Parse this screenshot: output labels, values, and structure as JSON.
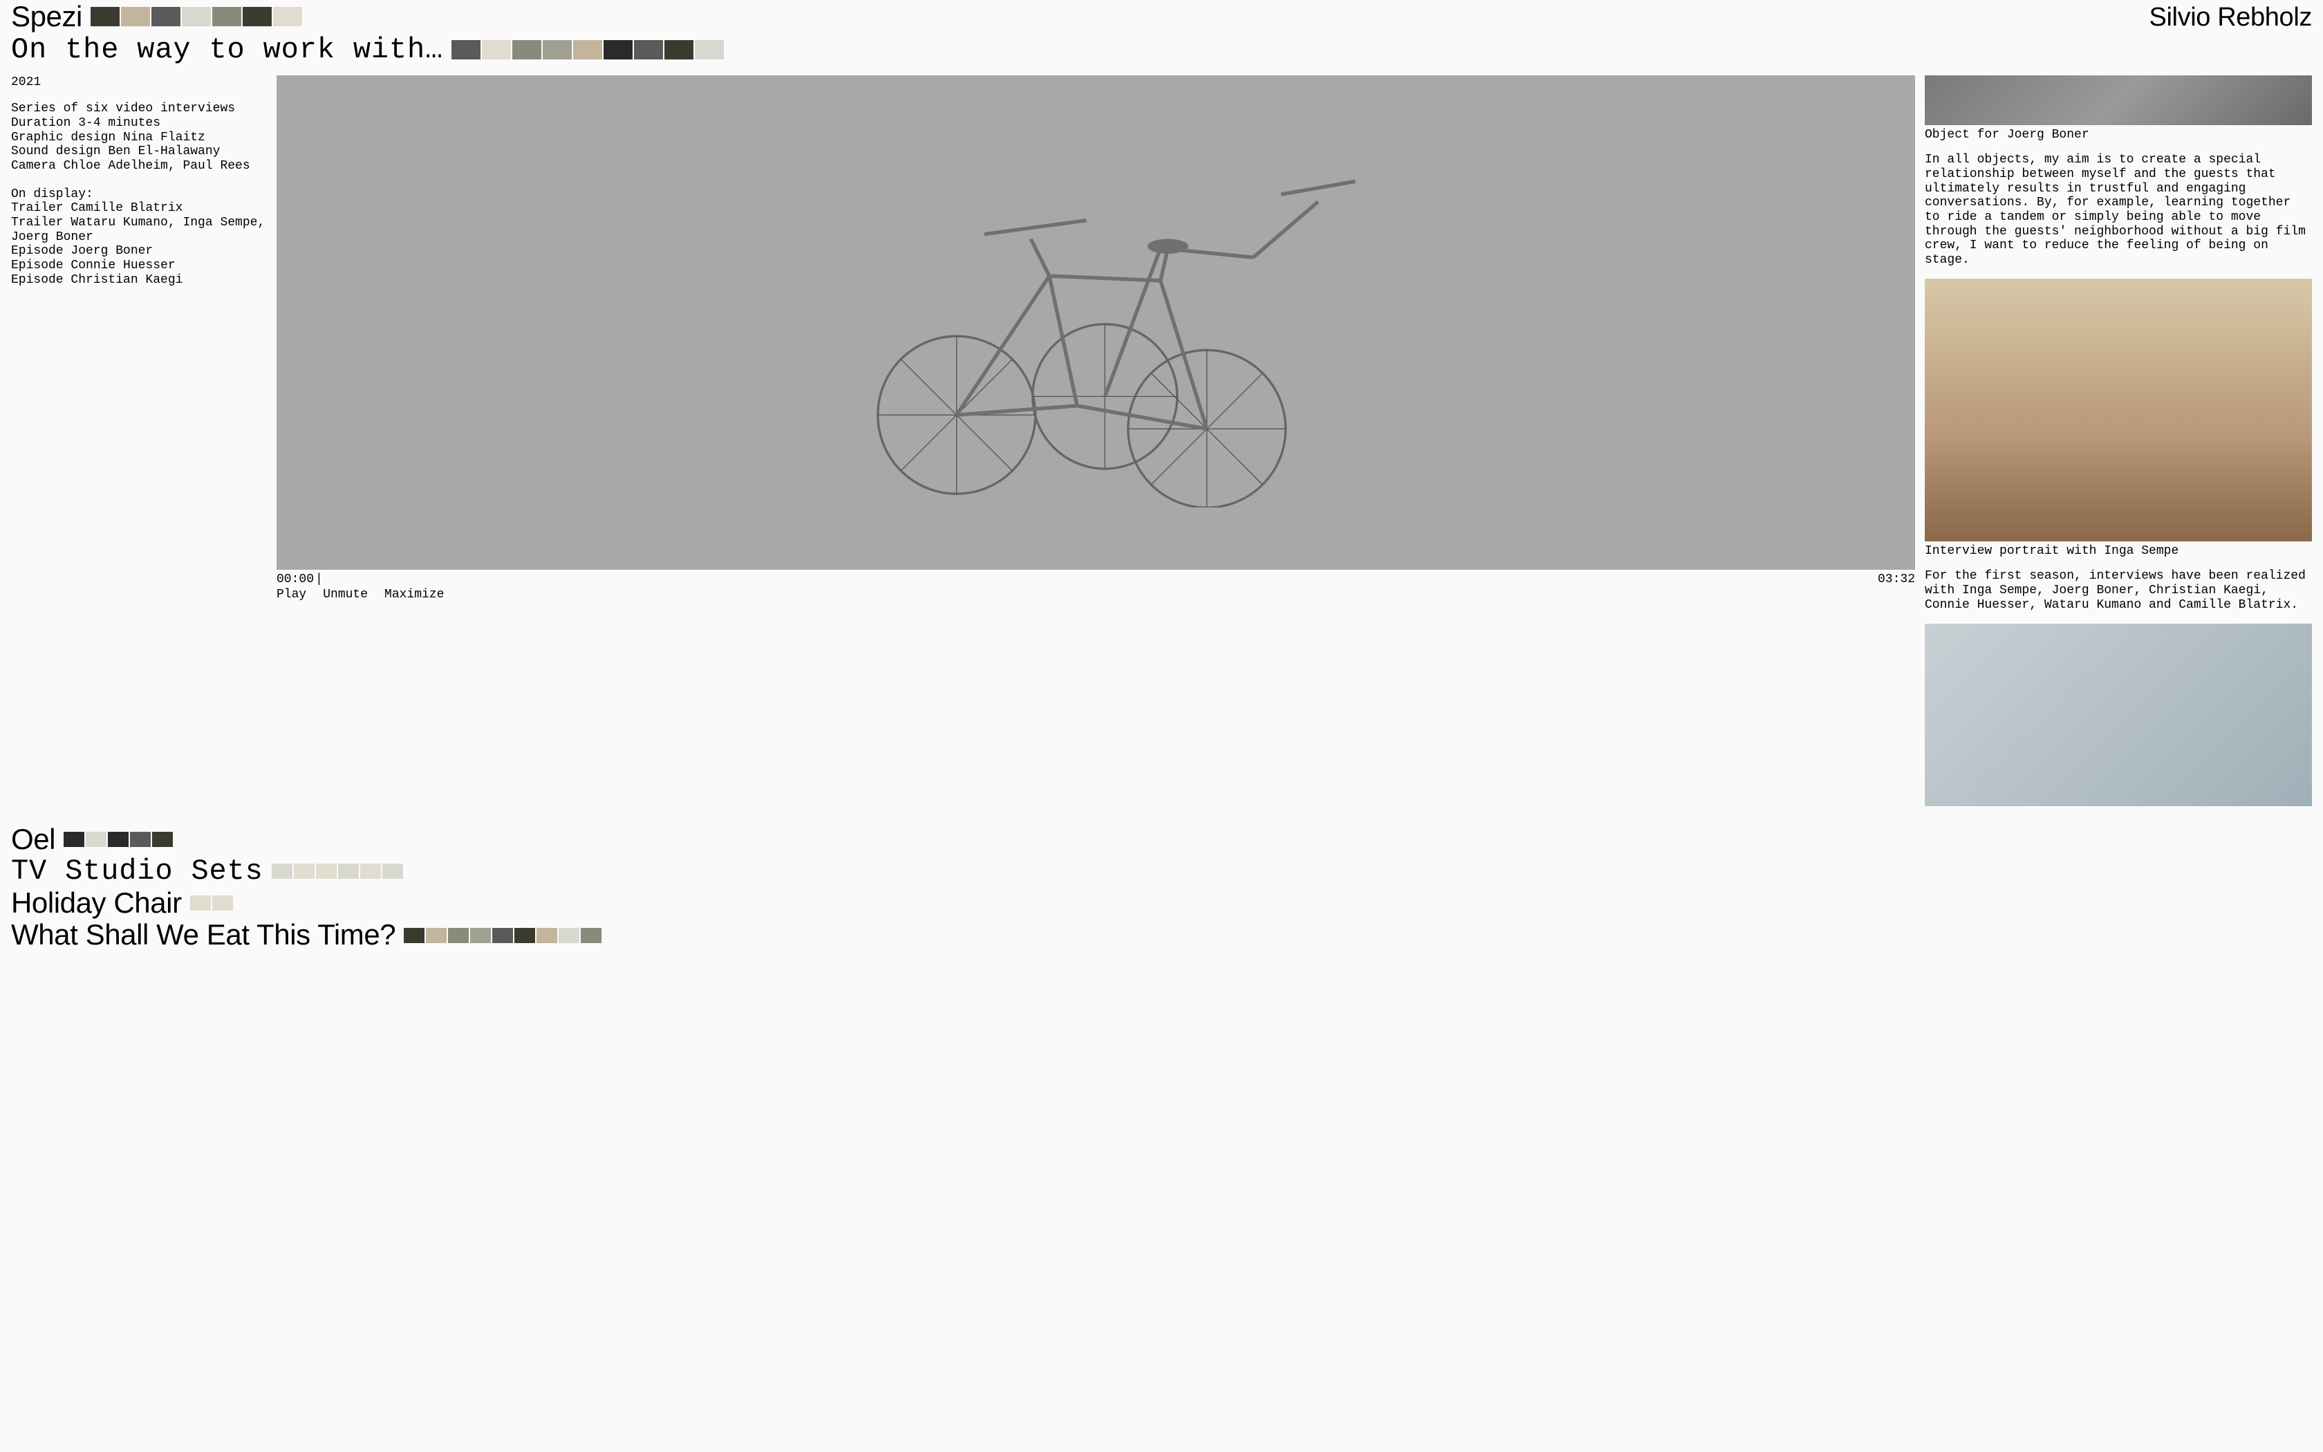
{
  "site_name": "Silvio Rebholz",
  "header_projects": [
    {
      "title": "Spezi",
      "font": "sans"
    },
    {
      "title": "On the way to work with…",
      "font": "mono"
    }
  ],
  "sidebar": {
    "year": "2021",
    "credits": [
      "Series of six video interviews",
      "Duration 3-4 minutes",
      "Graphic design Nina Flaitz",
      "Sound design Ben El-Halawany",
      "Camera Chloe Adelheim, Paul Rees"
    ],
    "display_label": "On display:",
    "display_items": [
      "Trailer Camille Blatrix",
      "Trailer Wataru Kumano, Inga Sempe, Joerg Boner",
      "Episode Joerg Boner",
      "Episode Connie Huesser",
      "Episode Christian Kaegi"
    ]
  },
  "video": {
    "time_current": "00:00",
    "time_total": "03:32",
    "controls": {
      "play": "Play",
      "unmute": "Unmute",
      "maximize": "Maximize"
    }
  },
  "right": {
    "caption1": "Object for Joerg Boner",
    "para1": "In all objects, my aim is to create a special relationship between myself and the guests that ultimately results in trustful and engaging conversations. By, for example, learning together to ride a tandem or simply being able to move through the guests' neighborhood without a big film crew, I want to reduce the feeling of being on stage.",
    "caption2": "Interview portrait with Inga Sempe",
    "para2": "For the first season, interviews have been realized with Inga Sempe, Joerg Boner, Christian Kaegi, Connie Huesser, Wataru Kumano and Camille Blatrix."
  },
  "bottom_projects": [
    {
      "title": "Oel",
      "font": "sans"
    },
    {
      "title": "TV Studio Sets",
      "font": "mono"
    },
    {
      "title": "Holiday Chair",
      "font": "sans"
    },
    {
      "title": "What Shall We Eat This Time?",
      "font": "sans"
    }
  ]
}
